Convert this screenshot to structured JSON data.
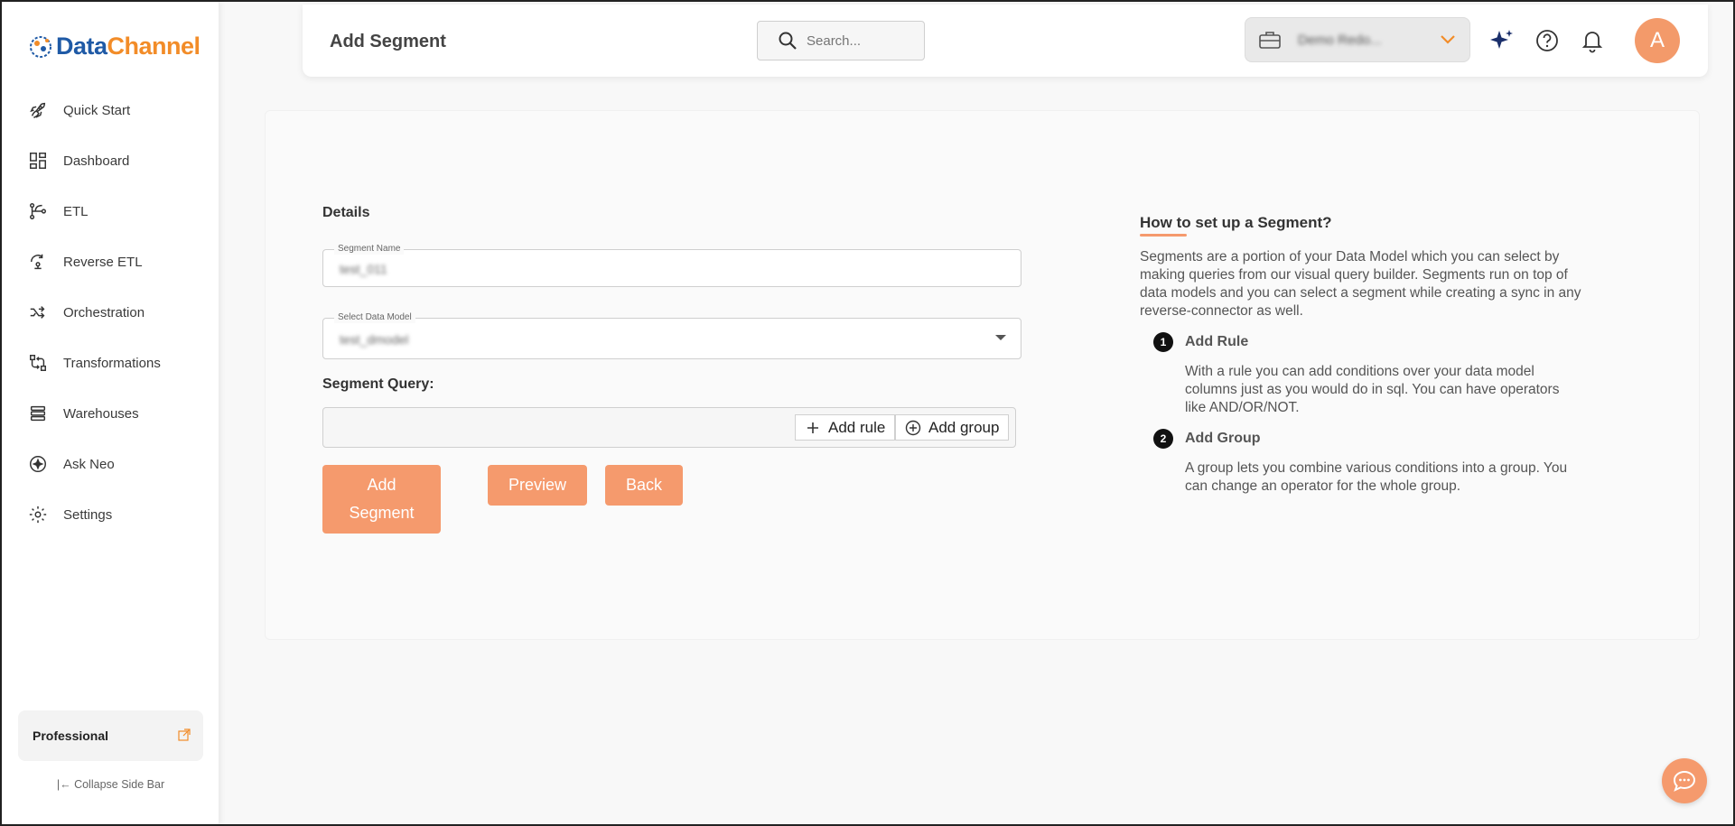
{
  "brand": {
    "name_part1": "Data",
    "name_part2": "Channel",
    "primary": "#1f5aa6",
    "accent": "#f28c28"
  },
  "sidebar": {
    "items": [
      {
        "label": "Quick Start",
        "icon": "rocket-icon"
      },
      {
        "label": "Dashboard",
        "icon": "dashboard-icon"
      },
      {
        "label": "ETL",
        "icon": "etl-icon"
      },
      {
        "label": "Reverse ETL",
        "icon": "reverse-etl-icon"
      },
      {
        "label": "Orchestration",
        "icon": "orchestration-icon"
      },
      {
        "label": "Transformations",
        "icon": "transformations-icon"
      },
      {
        "label": "Warehouses",
        "icon": "warehouses-icon"
      },
      {
        "label": "Ask Neo",
        "icon": "ask-neo-icon"
      },
      {
        "label": "Settings",
        "icon": "settings-icon"
      }
    ],
    "plan_label": "Professional",
    "collapse_label": "Collapse Side Bar"
  },
  "header": {
    "title": "Add Segment",
    "search_placeholder": "Search...",
    "workspace_name": "Demo Redo...",
    "avatar_initial": "A"
  },
  "form": {
    "section_title": "Details",
    "segment_name_label": "Segment Name",
    "segment_name_value": "test_011",
    "data_model_label": "Select Data Model",
    "data_model_value": "test_dmodel",
    "query_label": "Segment Query:",
    "add_rule_label": "Add rule",
    "add_group_label": "Add group",
    "add_segment_line1": "Add",
    "add_segment_line2": "Segment",
    "preview_label": "Preview",
    "back_label": "Back"
  },
  "help": {
    "title": "How to set up a Segment?",
    "intro": "Segments are a portion of your Data Model which you can select by making queries from our visual query builder. Segments run on top of data models and you can select a segment while creating a sync in any reverse-connector as well.",
    "steps": [
      {
        "num": "1",
        "title": "Add Rule",
        "text": "With a rule you can add conditions over your data model columns just as you would do in sql. You can have operators like AND/OR/NOT."
      },
      {
        "num": "2",
        "title": "Add Group",
        "text": "A group lets you combine various conditions into a group. You can change an operator for the whole group."
      }
    ]
  },
  "colors": {
    "accent_button": "#f59a6d",
    "avatar": "#f39a6a"
  }
}
